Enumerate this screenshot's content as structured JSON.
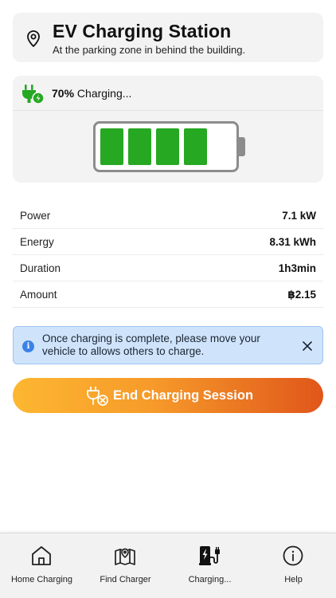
{
  "station": {
    "title": "EV Charging Station",
    "subtitle": "At the parking zone in behind the building.",
    "icon": "map-pin-icon"
  },
  "charging": {
    "percent_text": "70%",
    "status_text": "Charging...",
    "level_fraction": 0.7,
    "filled_cells": 4,
    "total_cells": 5,
    "cell_color": "#26a822"
  },
  "stats": [
    {
      "label": "Power",
      "value": "7.1 kW"
    },
    {
      "label": "Energy",
      "value": "8.31 kWh"
    },
    {
      "label": "Duration",
      "value": "1h3min"
    },
    {
      "label": "Amount",
      "value": "฿2.15"
    }
  ],
  "info": {
    "message": "Once charging is complete, please move your vehicle to allows others to charge.",
    "icon": "info-icon",
    "close_icon": "close-icon"
  },
  "end_button": {
    "label": "End Charging Session",
    "icon": "unplug-icon"
  },
  "tabs": [
    {
      "label": "Home Charging",
      "icon": "home-icon"
    },
    {
      "label": "Find Charger",
      "icon": "map-icon"
    },
    {
      "label": "Charging...",
      "icon": "charging-station-icon",
      "active": true
    },
    {
      "label": "Help",
      "icon": "help-icon"
    }
  ],
  "colors": {
    "accent_start": "#fdb731",
    "accent_end": "#e0561a",
    "info_bg": "#cfe4fb",
    "info_icon": "#3b82e6",
    "green": "#26a822"
  }
}
